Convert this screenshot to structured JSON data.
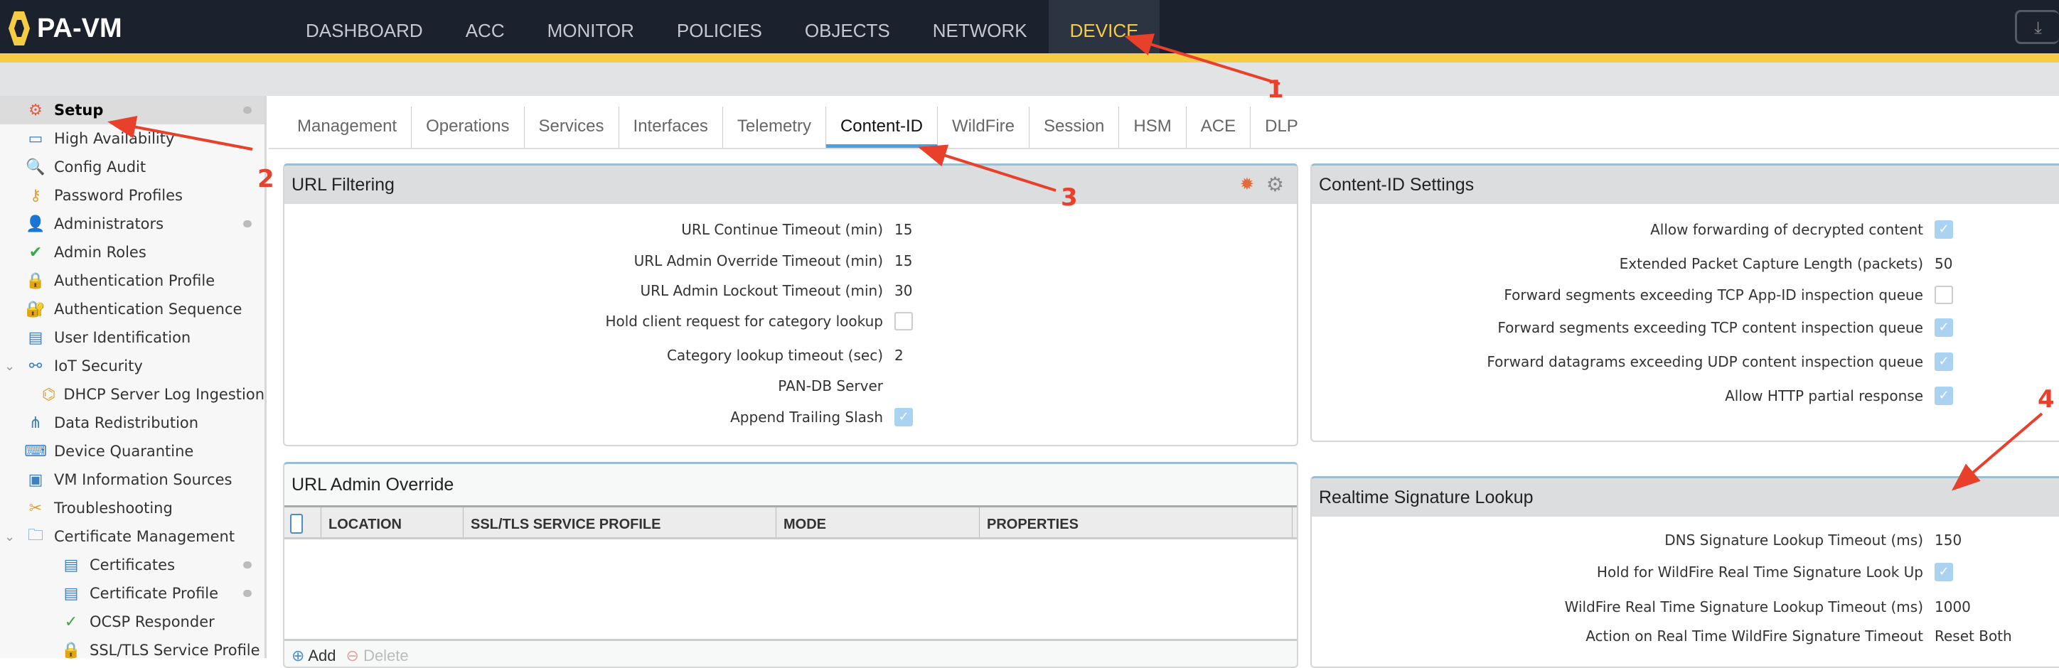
{
  "app": {
    "title": "PA-VM"
  },
  "nav": {
    "items": [
      "DASHBOARD",
      "ACC",
      "MONITOR",
      "POLICIES",
      "OBJECTS",
      "NETWORK",
      "DEVICE"
    ],
    "active": "DEVICE"
  },
  "sidebar": {
    "items": [
      {
        "label": "Setup",
        "icon": "setup-icon",
        "selected": true,
        "dot": true
      },
      {
        "label": "High Availability",
        "icon": "ha-icon"
      },
      {
        "label": "Config Audit",
        "icon": "audit-icon"
      },
      {
        "label": "Password Profiles",
        "icon": "key-icon"
      },
      {
        "label": "Administrators",
        "icon": "user-icon",
        "dot": true
      },
      {
        "label": "Admin Roles",
        "icon": "user-check-icon"
      },
      {
        "label": "Authentication Profile",
        "icon": "auth-icon"
      },
      {
        "label": "Authentication Sequence",
        "icon": "auth-seq-icon"
      },
      {
        "label": "User Identification",
        "icon": "id-card-icon"
      },
      {
        "label": "IoT Security",
        "icon": "iot-icon",
        "expanded": true
      },
      {
        "label": "DHCP Server Log Ingestion",
        "icon": "ip-icon",
        "indent": true
      },
      {
        "label": "Data Redistribution",
        "icon": "redistribution-icon"
      },
      {
        "label": "Device Quarantine",
        "icon": "quarantine-icon"
      },
      {
        "label": "VM Information Sources",
        "icon": "monitor-icon"
      },
      {
        "label": "Troubleshooting",
        "icon": "tools-icon"
      },
      {
        "label": "Certificate Management",
        "icon": "folder-cert-icon",
        "expanded": true
      },
      {
        "label": "Certificates",
        "icon": "certificate-icon",
        "indent": true,
        "dot": true
      },
      {
        "label": "Certificate Profile",
        "icon": "certificate-icon",
        "indent": true,
        "dot": true
      },
      {
        "label": "OCSP Responder",
        "icon": "ocsp-icon",
        "indent": true
      },
      {
        "label": "SSL/TLS Service Profile",
        "icon": "lock-icon",
        "indent": true
      }
    ]
  },
  "tabs": [
    "Management",
    "Operations",
    "Services",
    "Interfaces",
    "Telemetry",
    "Content-ID",
    "WildFire",
    "Session",
    "HSM",
    "ACE",
    "DLP"
  ],
  "url_filtering": {
    "title": "URL Filtering",
    "rows": [
      {
        "label": "URL Continue Timeout (min)",
        "value": "15"
      },
      {
        "label": "URL Admin Override Timeout (min)",
        "value": "15"
      },
      {
        "label": "URL Admin Lockout Timeout (min)",
        "value": "30"
      },
      {
        "label": "Hold client request for category lookup",
        "checked": false
      },
      {
        "label": "Category lookup timeout (sec)",
        "value": "2"
      },
      {
        "label": "PAN-DB Server",
        "value": ""
      },
      {
        "label": "Append Trailing Slash",
        "checked": true
      }
    ]
  },
  "url_admin_override": {
    "title": "URL Admin Override",
    "columns": [
      "LOCATION",
      "SSL/TLS SERVICE PROFILE",
      "MODE",
      "PROPERTIES"
    ],
    "add_label": "Add",
    "delete_label": "Delete"
  },
  "content_id_settings": {
    "title": "Content-ID Settings",
    "rows": [
      {
        "label": "Allow forwarding of decrypted content",
        "checked": true
      },
      {
        "label": "Extended Packet Capture Length (packets)",
        "value": "50"
      },
      {
        "label": "Forward segments exceeding TCP App-ID inspection queue",
        "checked": false
      },
      {
        "label": "Forward segments exceeding TCP content inspection queue",
        "checked": true
      },
      {
        "label": "Forward datagrams exceeding UDP content inspection queue",
        "checked": true
      },
      {
        "label": "Allow HTTP partial response",
        "checked": true
      }
    ]
  },
  "realtime": {
    "title": "Realtime Signature Lookup",
    "rows": [
      {
        "label": "DNS Signature Lookup Timeout (ms)",
        "value": "150"
      },
      {
        "label": "Hold for WildFire Real Time Signature Look Up",
        "checked": true
      },
      {
        "label": "WildFire Real Time Signature Lookup Timeout (ms)",
        "value": "1000"
      },
      {
        "label": "Action on Real Time WildFire Signature Timeout",
        "value": "Reset Both"
      }
    ]
  },
  "annotations": [
    "1",
    "2",
    "3",
    "4"
  ],
  "colors": {
    "accent": "#f6cc47",
    "topbar": "#1b212d",
    "tab_underline": "#4a9fe0",
    "annotation": "#e8402a"
  }
}
